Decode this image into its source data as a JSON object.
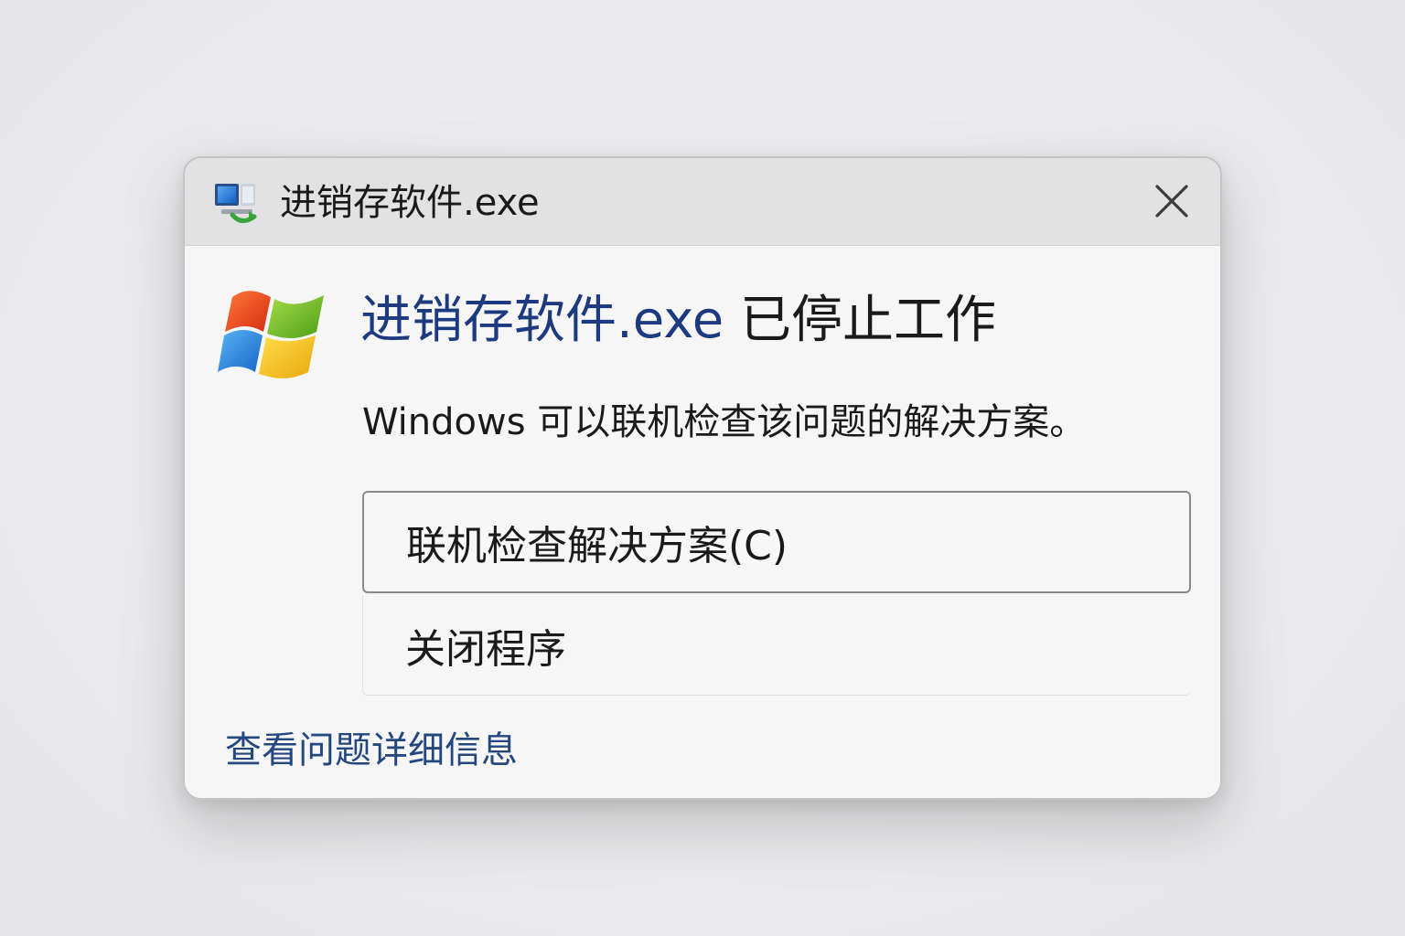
{
  "window": {
    "title": "进销存软件.exe",
    "app_icon": "monitor-refresh-icon",
    "close_icon": "close-icon"
  },
  "message": {
    "app_name": "进销存软件.exe",
    "stopped_text": " 已停止工作",
    "description": "Windows 可以联机检查该问题的解决方案。",
    "logo_icon": "windows-flag-logo"
  },
  "options": {
    "check_online": "联机检查解决方案(C)",
    "close_program": "关闭程序"
  },
  "footer": {
    "details_link": "查看问题详细信息"
  },
  "colors": {
    "headline_accent": "#1d3a80",
    "link": "#23477e",
    "titlebar": "#e2e2e3"
  }
}
